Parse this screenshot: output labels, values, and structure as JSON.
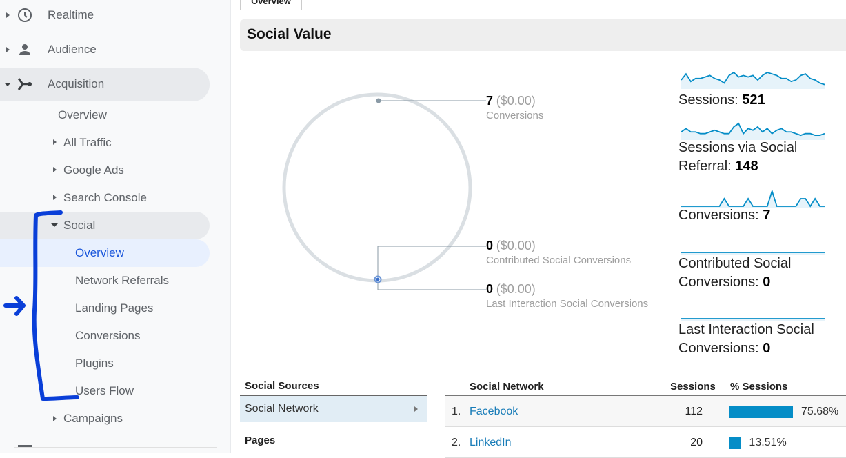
{
  "sidebar": {
    "items": [
      {
        "label": "Realtime",
        "icon": "clock-icon",
        "state": "collapsed"
      },
      {
        "label": "Audience",
        "icon": "person-icon",
        "state": "collapsed"
      },
      {
        "label": "Acquisition",
        "icon": "acquisition-icon",
        "state": "expanded"
      }
    ],
    "acquisition_children": [
      {
        "label": "Overview"
      },
      {
        "label": "All Traffic"
      },
      {
        "label": "Google Ads"
      },
      {
        "label": "Search Console"
      },
      {
        "label": "Social"
      },
      {
        "label": "Campaigns"
      }
    ],
    "social_children": [
      {
        "label": "Overview",
        "selected": true
      },
      {
        "label": "Network Referrals"
      },
      {
        "label": "Landing Pages"
      },
      {
        "label": "Conversions"
      },
      {
        "label": "Plugins"
      },
      {
        "label": "Users Flow"
      }
    ]
  },
  "tab": {
    "label": "Overview"
  },
  "section": {
    "title": "Social Value"
  },
  "ring": {
    "callouts": [
      {
        "value": "7",
        "money": "($0.00)",
        "label": "Conversions"
      },
      {
        "value": "0",
        "money": "($0.00)",
        "label": "Contributed Social Conversions"
      },
      {
        "value": "0",
        "money": "($0.00)",
        "label": "Last Interaction Social Conversions"
      }
    ]
  },
  "sparklines": [
    {
      "label": "Sessions:",
      "value": "521",
      "points": [
        5,
        9,
        4,
        6,
        6,
        7,
        8,
        6,
        5,
        3,
        8,
        10,
        7,
        8,
        7,
        8,
        5,
        8,
        10,
        9,
        8,
        6,
        6,
        4,
        5,
        8,
        9,
        6,
        5,
        3,
        2
      ]
    },
    {
      "label": "Sessions via Social Referral:",
      "value": "148",
      "points": [
        4,
        6,
        4,
        4,
        3,
        3,
        4,
        5,
        4,
        3,
        3,
        7,
        9,
        3,
        6,
        5,
        7,
        4,
        6,
        3,
        5,
        6,
        4,
        4,
        3,
        2,
        3,
        3,
        2,
        2,
        3
      ]
    },
    {
      "label": "Conversions:",
      "value": "7",
      "points": [
        0,
        0,
        0,
        0,
        0,
        0,
        0,
        0,
        0,
        1,
        0,
        0,
        0,
        0,
        1,
        0,
        0,
        0,
        0,
        2,
        0,
        0,
        0,
        0,
        0,
        1,
        1,
        0,
        1,
        0,
        0
      ]
    },
    {
      "label": "Contributed Social Conversions:",
      "value": "0",
      "points": [
        0,
        0,
        0,
        0,
        0,
        0,
        0,
        0,
        0,
        0,
        0,
        0,
        0,
        0,
        0,
        0,
        0,
        0,
        0,
        0,
        0,
        0,
        0,
        0,
        0,
        0,
        0,
        0,
        0,
        0,
        0
      ]
    },
    {
      "label": "Last Interaction Social Conversions:",
      "value": "0",
      "points": [
        0,
        0,
        0,
        0,
        0,
        0,
        0,
        0,
        0,
        0,
        0,
        0,
        0,
        0,
        0,
        0,
        0,
        0,
        0,
        0,
        0,
        0,
        0,
        0,
        0,
        0,
        0,
        0,
        0,
        0,
        0
      ]
    }
  ],
  "sources": {
    "heading": "Social Sources",
    "selected_row": "Social Network",
    "pages_heading": "Pages"
  },
  "network_table": {
    "columns": [
      "Social Network",
      "Sessions",
      "% Sessions"
    ],
    "rows": [
      {
        "rank": "1.",
        "name": "Facebook",
        "sessions": "112",
        "percent_label": "75.68%",
        "percent": 75.68
      },
      {
        "rank": "2.",
        "name": "LinkedIn",
        "sessions": "20",
        "percent_label": "13.51%",
        "percent": 13.51
      }
    ]
  },
  "colors": {
    "accent_blue": "#058dc7",
    "link_blue": "#1a7db8",
    "selected_nav": "#1a56db",
    "annotation": "#0a3fd8"
  }
}
